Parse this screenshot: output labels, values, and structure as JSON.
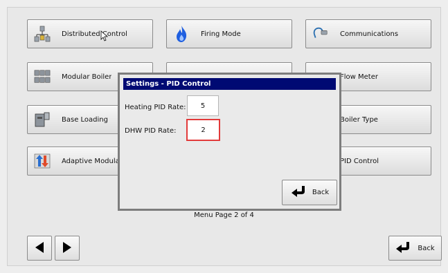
{
  "menu": {
    "tiles": [
      {
        "label": "Distributed Control",
        "icon": "distributed-control-icon"
      },
      {
        "label": "Firing Mode",
        "icon": "flame-icon"
      },
      {
        "label": "Communications",
        "icon": "communications-icon"
      },
      {
        "label": "Modular Boiler",
        "icon": "modular-boiler-icon"
      },
      {
        "label": "",
        "icon": ""
      },
      {
        "label": "Flow Meter",
        "icon": "flow-meter-icon"
      },
      {
        "label": "Base Loading",
        "icon": "base-loading-icon"
      },
      {
        "label": "",
        "icon": ""
      },
      {
        "label": "Boiler Type",
        "icon": "boiler-type-icon"
      },
      {
        "label": "Adaptive Modula",
        "icon": "adaptive-modulation-icon"
      },
      {
        "label": "",
        "icon": ""
      },
      {
        "label": "PID Control",
        "icon": "pid-control-icon"
      }
    ],
    "page_indicator": "Menu Page 2 of 4",
    "back_label": "Back"
  },
  "dialog": {
    "title": "Settings - PID Control",
    "heating_label": "Heating PID Rate:",
    "heating_value": "5",
    "dhw_label": "DHW PID Rate:",
    "dhw_value": "2",
    "back_label": "Back"
  },
  "colors": {
    "dialog_title_bg": "#000a73",
    "active_field_border": "#e23a3a",
    "flame": "#1f5fe0"
  }
}
